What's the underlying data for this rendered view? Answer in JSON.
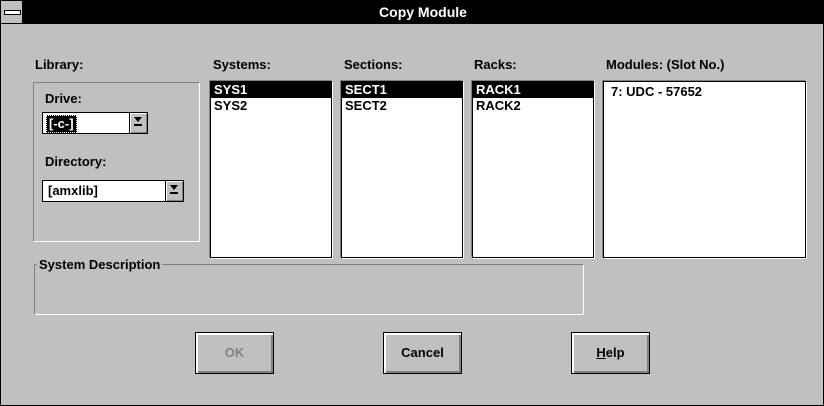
{
  "window": {
    "title": "Copy Module"
  },
  "library": {
    "label": "Library:",
    "drive_label": "Drive:",
    "drive_value": "[-c-]",
    "directory_label": "Directory:",
    "directory_value": "[amxlib]"
  },
  "systems": {
    "label": "Systems:",
    "items": [
      "SYS1",
      "SYS2"
    ],
    "selected": 0
  },
  "sections": {
    "label": "Sections:",
    "items": [
      "SECT1",
      "SECT2"
    ],
    "selected": 0
  },
  "racks": {
    "label": "Racks:",
    "items": [
      "RACK1",
      "RACK2"
    ],
    "selected": 0
  },
  "modules": {
    "label": "Modules:  (Slot No.)",
    "items": [
      "7: UDC - 57652"
    ]
  },
  "description": {
    "label": "System Description",
    "text": ""
  },
  "buttons": {
    "ok": "OK",
    "cancel": "Cancel",
    "help_mnemonic": "H",
    "help_rest": "elp"
  }
}
